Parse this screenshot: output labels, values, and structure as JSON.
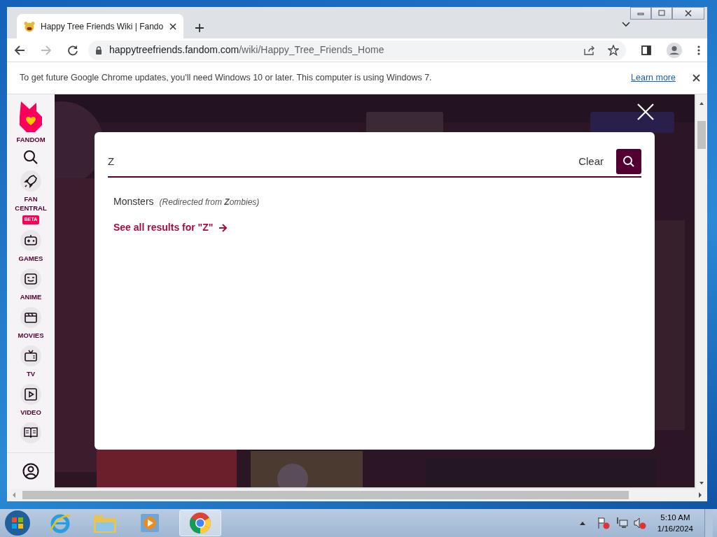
{
  "browser": {
    "tab_title": "Happy Tree Friends Wiki | Fando",
    "url_host": "happytreefriends.fandom.com",
    "url_path": "/wiki/Happy_Tree_Friends_Home"
  },
  "infobar": {
    "message": "To get future Google Chrome updates, you'll need Windows 10 or later. This computer is using Windows 7.",
    "link": "Learn more"
  },
  "sidebar": {
    "logo_label": "FANDOM",
    "items": [
      {
        "label": "FAN CENTRAL",
        "badge": "BETA"
      },
      {
        "label": "GAMES"
      },
      {
        "label": "ANIME"
      },
      {
        "label": "MOVIES"
      },
      {
        "label": "TV"
      },
      {
        "label": "VIDEO"
      }
    ]
  },
  "search": {
    "value": "Z",
    "clear": "Clear",
    "results": [
      {
        "title": "Monsters",
        "note": "(Redirected from **Z**ombies)"
      }
    ],
    "see_all": "See all results for \"Z\""
  },
  "taskbar": {
    "time": "5:10 AM",
    "date": "1/16/2024"
  }
}
